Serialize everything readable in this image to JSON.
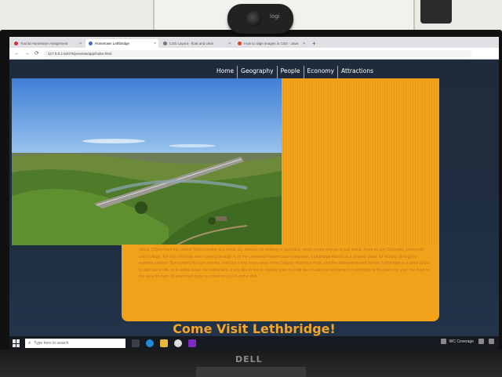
{
  "browser": {
    "tabs": [
      {
        "label": "Tourist Hometown Assignment"
      },
      {
        "label": "Hometown Lethbridge",
        "active": true
      },
      {
        "label": "CSS Layout - float and clear"
      },
      {
        "label": "How to align images in CSS - Java"
      }
    ],
    "new_tab_symbol": "+",
    "url": "127.0.0.1:64475/preview/app/index.html"
  },
  "site": {
    "nav": [
      "Home",
      "Geography",
      "People",
      "Economy",
      "Attractions"
    ],
    "intro_text": "About 125km from the United States border is a small city, famous for nothing in particular, which many choose to call home. From its airy Chinooks, University and College, the lazy Old Man river running through it, to the converted Waterhouse restaurant, Lethbridge Alberta is a popular place for tourists during the summer season. Surrounded by lush prairies, and just a few hours away from Calgary, Waterton Park, and the aforementioned border, Lethbridge is a great place to start out in life, or to settle down into retirement. If you like to live in relative quiet but still like occasional excitement, Lethbridge is the place for you! I've lived in the area for over 20 years and hope to convince you to come visit.",
    "cta": "Come Visit Lethbridge!",
    "colors": {
      "accent": "#f2a21a",
      "background": "#1e2b3c",
      "cta": "#f5a623"
    }
  },
  "taskbar": {
    "search_placeholder": "Type here to search",
    "tray_label": "WC Coverage"
  },
  "hardware": {
    "monitor_brand": "DELL",
    "webcam_brand": "logi"
  }
}
